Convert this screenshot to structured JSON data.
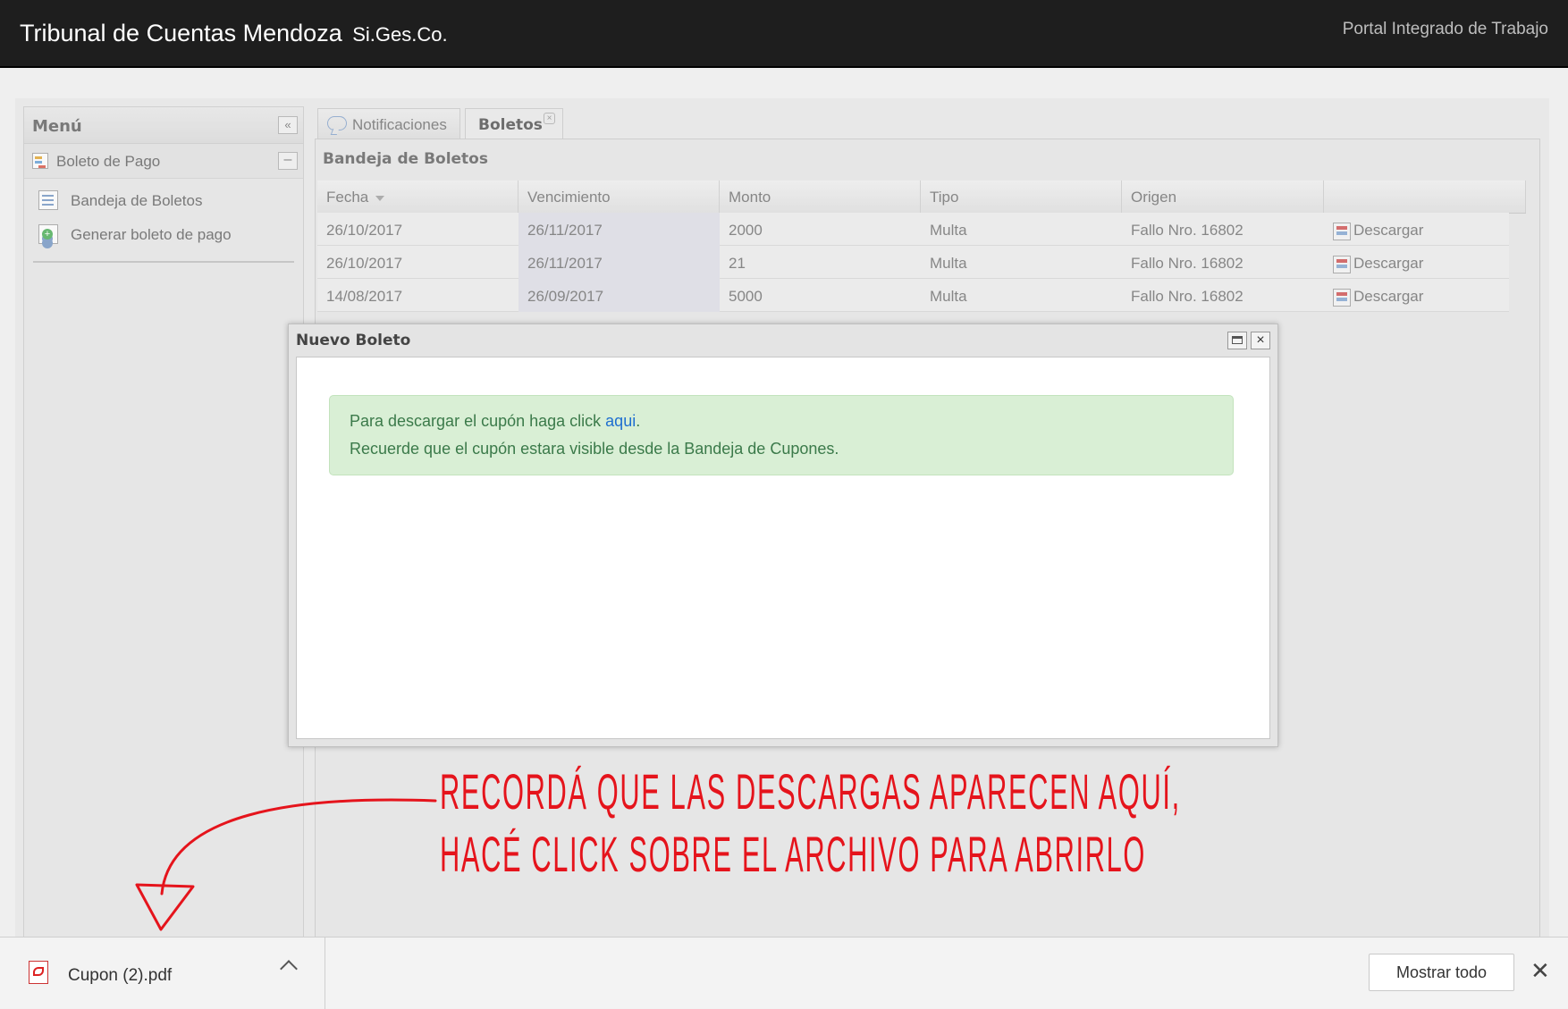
{
  "header": {
    "brand": "Tribunal de Cuentas Mendoza",
    "brand_sub": "Si.Ges.Co.",
    "portal": "Portal Integrado de Trabajo"
  },
  "menu": {
    "title": "Menú",
    "collapse_glyph": "«",
    "section_title": "Boleto de Pago",
    "section_toggle": "–",
    "items": [
      {
        "label": "Bandeja de Boletos",
        "icon": "document-list-icon"
      },
      {
        "label": "Generar boleto de pago",
        "icon": "add-document-icon"
      }
    ]
  },
  "tabs": [
    {
      "label": "Notificaciones",
      "icon": "chat-bubbles-icon"
    },
    {
      "label": "Boletos",
      "close_glyph": "×"
    }
  ],
  "grid": {
    "title": "Bandeja de Boletos",
    "columns": [
      "Fecha",
      "Vencimiento",
      "Monto",
      "Tipo",
      "Origen",
      ""
    ],
    "rows": [
      {
        "fecha": "26/10/2017",
        "vencimiento": "26/11/2017",
        "monto": "2000",
        "tipo": "Multa",
        "origen": "Fallo Nro. 16802",
        "accion": "Descargar"
      },
      {
        "fecha": "26/10/2017",
        "vencimiento": "26/11/2017",
        "monto": "21",
        "tipo": "Multa",
        "origen": "Fallo Nro. 16802",
        "accion": "Descargar"
      },
      {
        "fecha": "14/08/2017",
        "vencimiento": "26/09/2017",
        "monto": "5000",
        "tipo": "Multa",
        "origen": "Fallo Nro. 16802",
        "accion": "Descargar"
      }
    ]
  },
  "modal": {
    "title": "Nuevo Boleto",
    "close_glyph": "×",
    "alert_prefix": "Para descargar el cupón haga click ",
    "alert_link": "aqui",
    "alert_suffix": ".",
    "alert_line2": "Recuerde que el cupón estara visible desde la Bandeja de Cupones."
  },
  "annotation": {
    "line1": "RECORDÁ QUE LAS DESCARGAS APARECEN AQUÍ,",
    "line2": "HACÉ CLICK SOBRE EL ARCHIVO PARA ABRIRLO",
    "color": "#e5141c"
  },
  "download_bar": {
    "file_name": "Cupon (2).pdf",
    "file_icon": "pdf-icon",
    "show_all": "Mostrar todo",
    "close_glyph": "✕"
  }
}
